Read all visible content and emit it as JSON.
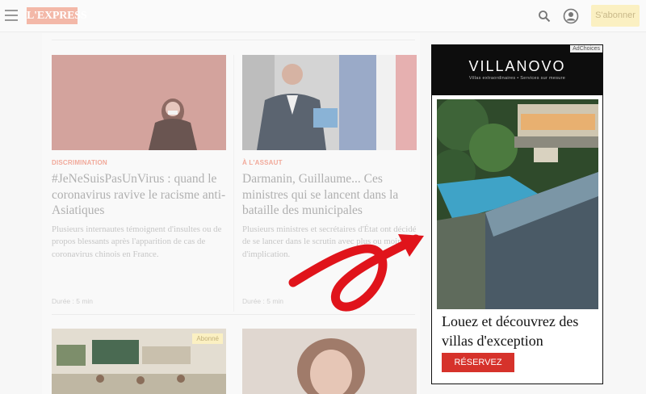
{
  "header": {
    "logo_text": "L'EXPRESS",
    "subscribe_label": "S'abonner",
    "menu_icon": "hamburger-icon",
    "search_icon": "search-icon",
    "account_icon": "account-icon"
  },
  "articles": [
    {
      "category": "DISCRIMINATION",
      "title": "#JeNeSuisPasUnVirus : quand le coronavirus ravive le racisme anti-Asiatiques",
      "excerpt": "Plusieurs internautes témoignent d'insultes ou de propos blessants après l'apparition de cas de coronavirus chinois en France.",
      "meta": "Durée : 5 min"
    },
    {
      "category": "À L'ASSAUT",
      "title": "Darmanin, Guillaume... Ces ministres qui se lancent dans la bataille des municipales",
      "excerpt": "Plusieurs ministres et secrétaires d'État ont décidé de se lancer dans le scrutin avec plus ou moins d'implication.",
      "meta": "Durée : 5 min"
    },
    {
      "badge": "Abonné"
    },
    {}
  ],
  "ad": {
    "adchoices": "AdChoices",
    "brand": "VILLANOVO",
    "tagline": "Villas extraordinaires • Services sur mesure",
    "headline": "Louez et découvrez des villas d'exception",
    "button": "RÉSERVEZ"
  },
  "colors": {
    "category": "#f1a99a",
    "ad_button": "#d6322b",
    "arrow": "#e0141b",
    "subscribe_bg": "#fbf0c2"
  }
}
